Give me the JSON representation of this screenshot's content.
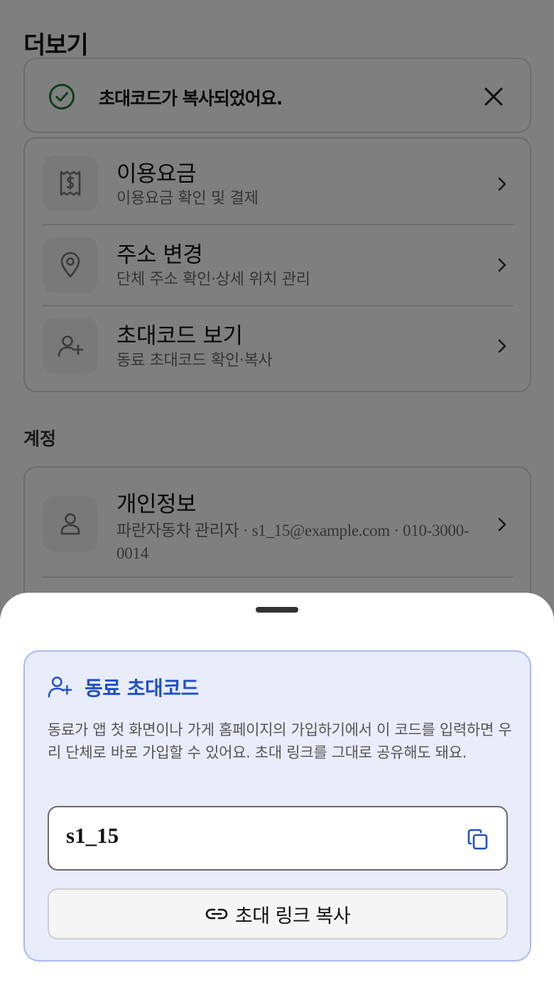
{
  "page": {
    "title": "더보기"
  },
  "toast": {
    "message": "초대코드가 복사되었어요."
  },
  "menu": {
    "items": [
      {
        "title": "이용요금",
        "subtitle": "이용요금 확인 및 결제",
        "icon": "receipt-dollar-icon"
      },
      {
        "title": "주소 변경",
        "subtitle": "단체 주소 확인·상세 위치 관리",
        "icon": "map-pin-icon"
      },
      {
        "title": "초대코드 보기",
        "subtitle": "동료 초대코드 확인·복사",
        "icon": "user-plus-icon"
      }
    ]
  },
  "account": {
    "section_label": "계정",
    "items": [
      {
        "title": "개인정보",
        "subtitle": "파란자동차 관리자 · s1_15@example.com · 010-3000-0014",
        "icon": "user-icon"
      }
    ]
  },
  "sheet": {
    "title": "동료 초대코드",
    "description": "동료가 앱 첫 화면이나 가게 홈페이지의 가입하기에서 이 코드를 입력하면 우리 단체로 바로 가입할 수 있어요. 초대 링크를 그대로 공유해도 돼요.",
    "code": "s1_15",
    "link_button_label": "초대 링크 복사"
  },
  "colors": {
    "accent": "#1f4ec7",
    "success": "#1e7a3a",
    "panel_bg": "#e9ecfb",
    "panel_border": "#a9bbee"
  }
}
